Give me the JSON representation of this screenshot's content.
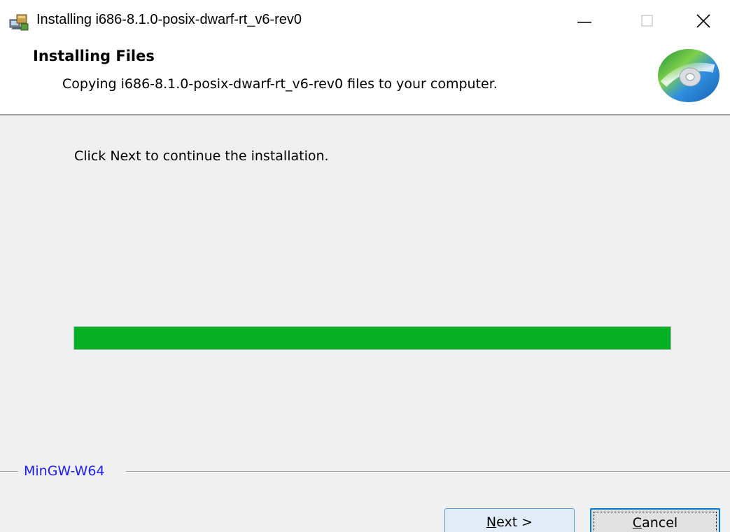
{
  "window": {
    "title": "Installing i686-8.1.0-posix-dwarf-rt_v6-rev0",
    "icon": "installer-icon",
    "controls": [
      "minimize-icon",
      "maximize-icon",
      "close-icon"
    ]
  },
  "header": {
    "heading": "Installing Files",
    "subheading": "Copying i686-8.1.0-posix-dwarf-rt_v6-rev0 files to your computer.",
    "icon": "disc-icon"
  },
  "body": {
    "instruction": "Click Next to continue the installation.",
    "progress": 1.0
  },
  "branding": {
    "text": "MinGW-W64"
  },
  "buttons": {
    "next": {
      "mnemonic": "N",
      "rest": "ext >"
    },
    "cancel": {
      "mnemonic": "C",
      "rest": "ancel"
    }
  },
  "colors": {
    "progress_fill": "#06b025",
    "branding_text": "#1a1aff",
    "focus_border": "#0078d7"
  }
}
